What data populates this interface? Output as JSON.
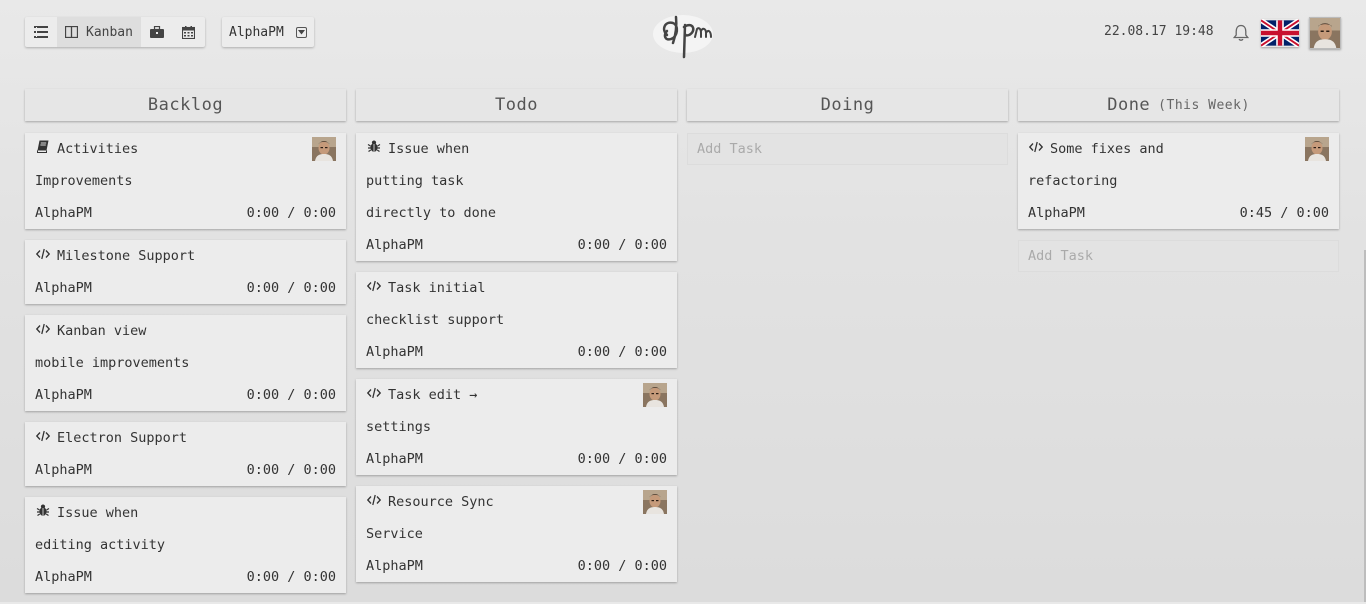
{
  "toolbar": {
    "kanban_label": "Kanban",
    "project_select_value": "AlphaPM"
  },
  "header": {
    "datetime": "22.08.17 19:48",
    "logo_text": "αpm"
  },
  "columns": [
    {
      "title": "Backlog",
      "subtitle": "",
      "cards": [
        {
          "icon": "book-icon",
          "lines": [
            "Activities",
            "Improvements"
          ],
          "project": "AlphaPM",
          "time": "0:00 / 0:00",
          "has_avatar": true
        },
        {
          "icon": "code-icon",
          "lines": [
            "Milestone Support"
          ],
          "project": "AlphaPM",
          "time": "0:00 / 0:00",
          "has_avatar": false
        },
        {
          "icon": "code-icon",
          "lines": [
            "Kanban view",
            "mobile improvements"
          ],
          "project": "AlphaPM",
          "time": "0:00 / 0:00",
          "has_avatar": false
        },
        {
          "icon": "code-icon",
          "lines": [
            "Electron Support"
          ],
          "project": "AlphaPM",
          "time": "0:00 / 0:00",
          "has_avatar": false
        },
        {
          "icon": "bug-icon",
          "lines": [
            "Issue when",
            "editing activity"
          ],
          "project": "AlphaPM",
          "time": "0:00 / 0:00",
          "has_avatar": false
        }
      ]
    },
    {
      "title": "Todo",
      "subtitle": "",
      "cards": [
        {
          "icon": "bug-icon",
          "lines": [
            "Issue when",
            "putting task",
            "directly to done"
          ],
          "project": "AlphaPM",
          "time": "0:00 / 0:00",
          "has_avatar": false
        },
        {
          "icon": "code-icon",
          "lines": [
            "Task initial",
            "checklist support"
          ],
          "project": "AlphaPM",
          "time": "0:00 / 0:00",
          "has_avatar": false
        },
        {
          "icon": "code-icon",
          "lines": [
            "Task edit →",
            "settings"
          ],
          "project": "AlphaPM",
          "time": "0:00 / 0:00",
          "has_avatar": true
        },
        {
          "icon": "code-icon",
          "lines": [
            "Resource Sync",
            "Service"
          ],
          "project": "AlphaPM",
          "time": "0:00 / 0:00",
          "has_avatar": true
        }
      ]
    },
    {
      "title": "Doing",
      "subtitle": "",
      "cards": [],
      "add_task_placeholder": "Add Task"
    },
    {
      "title": "Done",
      "subtitle": "(This Week)",
      "cards": [
        {
          "icon": "code-icon",
          "lines": [
            "Some fixes and",
            "refactoring"
          ],
          "project": "AlphaPM",
          "time": "0:45 / 0:00",
          "has_avatar": true
        }
      ],
      "add_task_placeholder": "Add Task"
    }
  ]
}
